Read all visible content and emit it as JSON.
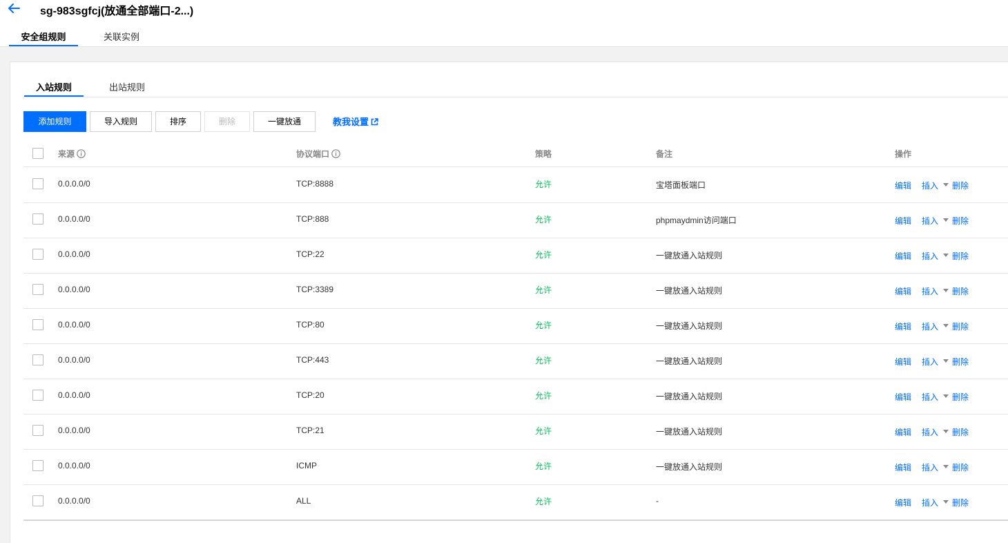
{
  "header": {
    "title": "sg-983sgfcj(放通全部端口-2...)",
    "tabs": [
      {
        "label": "安全组规则",
        "active": true
      },
      {
        "label": "关联实例",
        "active": false
      }
    ]
  },
  "rules": {
    "subtabs": [
      {
        "label": "入站规则",
        "active": true
      },
      {
        "label": "出站规则",
        "active": false
      }
    ],
    "toolbar": {
      "add": "添加规则",
      "import": "导入规则",
      "sort": "排序",
      "delete": "删除",
      "open_all": "一键放通",
      "help": "教我设置"
    },
    "columns": {
      "source": "来源",
      "port": "协议端口",
      "policy": "策略",
      "note": "备注",
      "ops": "操作"
    },
    "row_ops": {
      "edit": "编辑",
      "insert": "插入",
      "delete": "删除"
    },
    "rows": [
      {
        "source": "0.0.0.0/0",
        "port": "TCP:8888",
        "policy": "允许",
        "note": "宝塔面板端口"
      },
      {
        "source": "0.0.0.0/0",
        "port": "TCP:888",
        "policy": "允许",
        "note": "phpmaydmin访问端口"
      },
      {
        "source": "0.0.0.0/0",
        "port": "TCP:22",
        "policy": "允许",
        "note": "一键放通入站规则"
      },
      {
        "source": "0.0.0.0/0",
        "port": "TCP:3389",
        "policy": "允许",
        "note": "一键放通入站规则"
      },
      {
        "source": "0.0.0.0/0",
        "port": "TCP:80",
        "policy": "允许",
        "note": "一键放通入站规则"
      },
      {
        "source": "0.0.0.0/0",
        "port": "TCP:443",
        "policy": "允许",
        "note": "一键放通入站规则"
      },
      {
        "source": "0.0.0.0/0",
        "port": "TCP:20",
        "policy": "允许",
        "note": "一键放通入站规则"
      },
      {
        "source": "0.0.0.0/0",
        "port": "TCP:21",
        "policy": "允许",
        "note": "一键放通入站规则"
      },
      {
        "source": "0.0.0.0/0",
        "port": "ICMP",
        "policy": "允许",
        "note": "一键放通入站规则"
      },
      {
        "source": "0.0.0.0/0",
        "port": "ALL",
        "policy": "允许",
        "note": "-"
      }
    ]
  },
  "colors": {
    "accent": "#006eff",
    "allow": "#0abf5b",
    "page_bg": "#f2f2f2"
  },
  "icons": [
    "back-arrow-icon",
    "info-icon",
    "external-link-icon",
    "caret-down-icon"
  ]
}
